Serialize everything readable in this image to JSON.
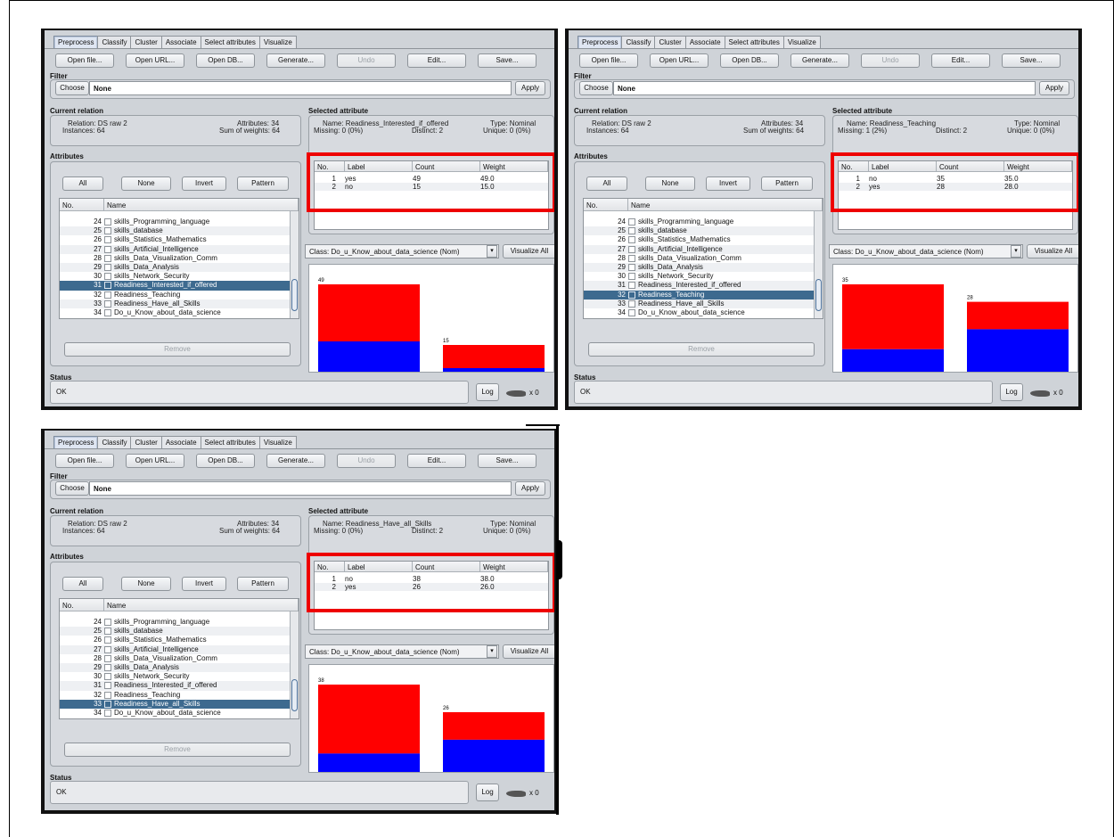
{
  "tabs": [
    "Preprocess",
    "Classify",
    "Cluster",
    "Associate",
    "Select attributes",
    "Visualize"
  ],
  "buttons": {
    "open_file": "Open file...",
    "open_url": "Open URL...",
    "open_db": "Open DB...",
    "generate": "Generate...",
    "undo": "Undo",
    "edit": "Edit...",
    "save": "Save..."
  },
  "filter": {
    "section": "Filter",
    "choose": "Choose",
    "value": "None",
    "apply": "Apply"
  },
  "current_relation": {
    "section": "Current relation",
    "relation": "Relation: DS raw 2",
    "instances": "Instances: 64",
    "attributes": "Attributes: 34",
    "sum_weights": "Sum of weights: 64"
  },
  "attributes_section": {
    "section": "Attributes",
    "all": "All",
    "none": "None",
    "invert": "Invert",
    "pattern": "Pattern",
    "col_no": "No.",
    "col_name": "Name",
    "remove": "Remove",
    "rows": [
      {
        "no": "24",
        "name": "skills_Programming_language"
      },
      {
        "no": "25",
        "name": "skills_database"
      },
      {
        "no": "26",
        "name": "skills_Statistics_Mathematics"
      },
      {
        "no": "27",
        "name": "skills_Artificial_Intelligence"
      },
      {
        "no": "28",
        "name": "skills_Data_Visualization_Comm"
      },
      {
        "no": "29",
        "name": "skills_Data_Analysis"
      },
      {
        "no": "30",
        "name": "skills_Network_Security"
      },
      {
        "no": "31",
        "name": "Readiness_Interested_if_offered"
      },
      {
        "no": "32",
        "name": "Readiness_Teaching"
      },
      {
        "no": "33",
        "name": "Readiness_Have_all_Skills"
      },
      {
        "no": "34",
        "name": "Do_u_Know_about_data_science"
      }
    ]
  },
  "selected_section": "Selected attribute",
  "table_headers": {
    "no": "No.",
    "label": "Label",
    "count": "Count",
    "weight": "Weight"
  },
  "class_select": "Class: Do_u_Know_about_data_science (Nom)",
  "visualize_all": "Visualize All",
  "status": {
    "section": "Status",
    "text": "OK",
    "log": "Log",
    "count": "x 0"
  },
  "colors": {
    "red": "#ff0000",
    "blue": "#0000ff",
    "highlight": "#ee0000",
    "selected_row": "#3d6a8f"
  },
  "panels": [
    {
      "selected_index": 7,
      "name": "Name: Readiness_Interested_if_offered",
      "missing": "Missing: 0 (0%)",
      "distinct": "Distinct: 2",
      "type": "Type: Nominal",
      "unique": "Unique: 0 (0%)",
      "rows": [
        {
          "no": "1",
          "label": "yes",
          "count": "49",
          "weight": "49.0"
        },
        {
          "no": "2",
          "label": "no",
          "count": "15",
          "weight": "15.0"
        }
      ],
      "bars": [
        {
          "label": "49",
          "total": 49,
          "blue": 17
        },
        {
          "label": "15",
          "total": 15,
          "blue": 2
        }
      ]
    },
    {
      "selected_index": 8,
      "name": "Name: Readiness_Teaching",
      "missing": "Missing: 1 (2%)",
      "distinct": "Distinct: 2",
      "type": "Type: Nominal",
      "unique": "Unique: 0 (0%)",
      "rows": [
        {
          "no": "1",
          "label": "no",
          "count": "35",
          "weight": "35.0"
        },
        {
          "no": "2",
          "label": "yes",
          "count": "28",
          "weight": "28.0"
        }
      ],
      "bars": [
        {
          "label": "35",
          "total": 35,
          "blue": 9
        },
        {
          "label": "28",
          "total": 28,
          "blue": 17
        }
      ]
    },
    {
      "selected_index": 9,
      "name": "Name: Readiness_Have_all_Skills",
      "missing": "Missing: 0 (0%)",
      "distinct": "Distinct: 2",
      "type": "Type: Nominal",
      "unique": "Unique: 0 (0%)",
      "rows": [
        {
          "no": "1",
          "label": "no",
          "count": "38",
          "weight": "38.0"
        },
        {
          "no": "2",
          "label": "yes",
          "count": "26",
          "weight": "26.0"
        }
      ],
      "bars": [
        {
          "label": "38",
          "total": 38,
          "blue": 8
        },
        {
          "label": "26",
          "total": 26,
          "blue": 14
        }
      ]
    }
  ]
}
